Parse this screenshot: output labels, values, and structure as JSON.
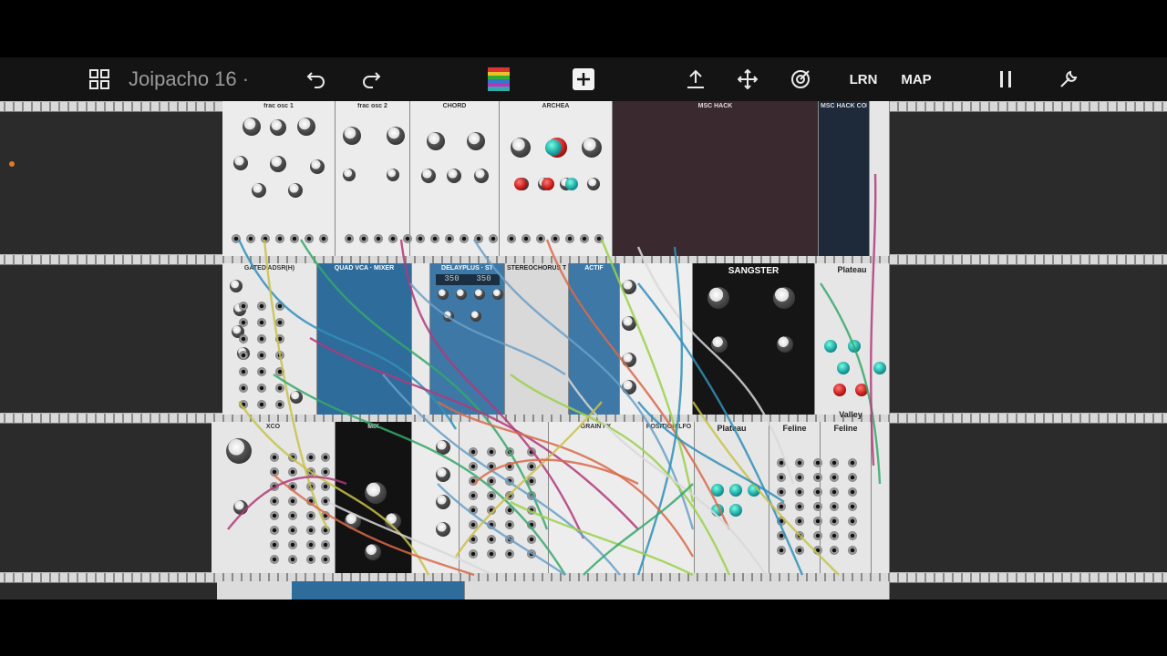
{
  "toolbar": {
    "patch_title": "Joipacho 16 ·",
    "learn_label": "LRN",
    "map_label": "MAP"
  },
  "icons": {
    "browser": "grid-icon",
    "undo": "undo-icon",
    "redo": "redo-icon",
    "colors": "cable-color-icon",
    "add": "plus-icon",
    "export": "upload-icon",
    "move": "move-arrows-icon",
    "focus": "target-icon",
    "pause": "pause-icon",
    "settings": "wrench-icon"
  },
  "colors": {
    "toolbar_bg": "#141414",
    "rack_bg": "#2b2b2b",
    "accent_orange": "#e07a2a"
  },
  "modules": {
    "row1": [
      "frac osc 1",
      "frac osc 2",
      "CHORD",
      "ARCHEA",
      "MSC HACK",
      "MSC HACK COMPRESSOR"
    ],
    "row2": [
      "GATED ADSR(H)",
      "QUAD VCA · MIXER",
      "DELAYPLUS · ST",
      "STEREOCHORUS TREMOLO",
      "ACTIF",
      "SANGSTER",
      "Plateau"
    ],
    "row3": [
      "XCO",
      "MIX",
      "GRAIN FX",
      "POSITION LFO",
      "Plateau",
      "Feline",
      "Feline",
      "Valley"
    ],
    "sangster_title": "SANGSTER",
    "plateau_title": "Plateau",
    "feline_title": "Feline",
    "valley_title": "Valley",
    "delay_display_left": "350",
    "delay_display_right": "350"
  }
}
